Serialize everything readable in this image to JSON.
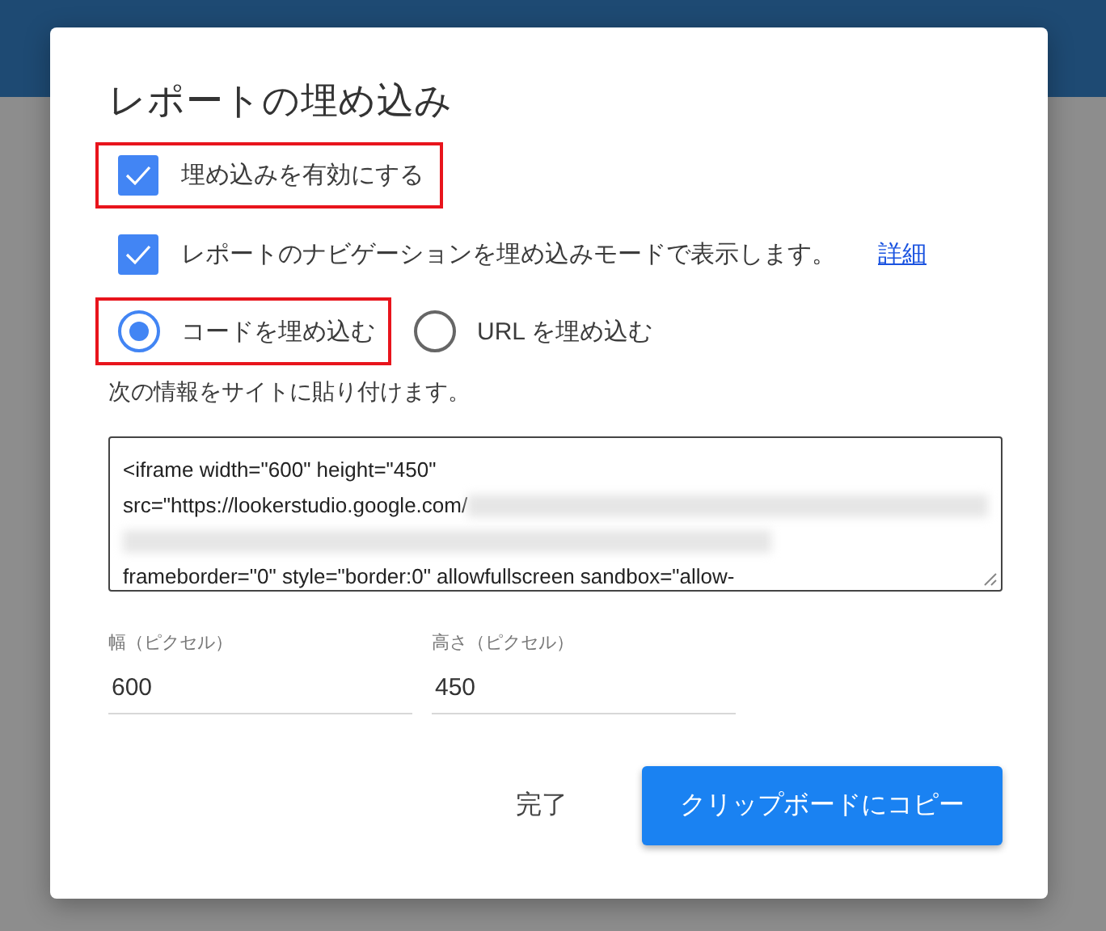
{
  "dialog": {
    "title": "レポートの埋め込み",
    "options": [
      {
        "label": "埋め込みを有効にする",
        "checked": true,
        "highlighted": true
      },
      {
        "label": "レポートのナビゲーションを埋め込みモードで表示します。",
        "checked": true,
        "highlighted": false,
        "link": "詳細"
      }
    ],
    "embed_modes": [
      {
        "label": "コードを埋め込む",
        "selected": true,
        "highlighted": true
      },
      {
        "label": "URL を埋め込む",
        "selected": false,
        "highlighted": false
      }
    ],
    "instruction": "次の情報をサイトに貼り付けます。",
    "code_lines": [
      {
        "kind": "text",
        "text": "<iframe width=\"600\" height=\"450\"",
        "redacted_tail": false
      },
      {
        "kind": "text",
        "text": "src=\"https://lookerstudio.google.com/",
        "redacted_tail": true
      },
      {
        "kind": "redacted"
      },
      {
        "kind": "text",
        "text": "frameborder=\"0\" style=\"border:0\" allowfullscreen sandbox=\"allow-",
        "redacted_tail": false
      }
    ],
    "fields": [
      {
        "label": "幅（ピクセル）",
        "value": "600"
      },
      {
        "label": "高さ（ピクセル）",
        "value": "450"
      }
    ],
    "buttons": [
      {
        "label": "完了",
        "kind": "text"
      },
      {
        "label": "クリップボードにコピー",
        "kind": "raised"
      }
    ]
  }
}
